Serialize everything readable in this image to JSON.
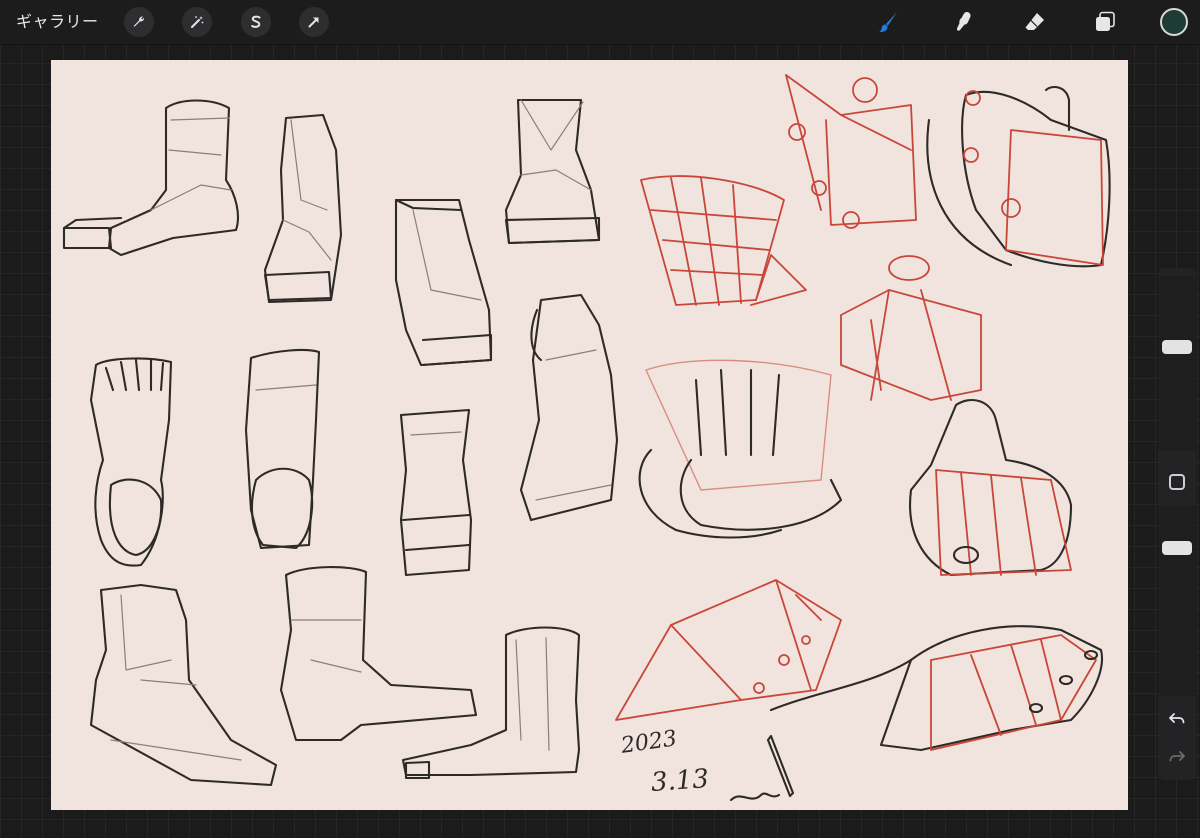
{
  "app": {
    "gallery_label": "ギャラリー",
    "color_swatch": "#1f3b36",
    "canvas_bg": "#f1e4de",
    "accent": "#1e7fe6"
  },
  "toolbar_left": [
    {
      "name": "wrench-icon"
    },
    {
      "name": "magic-wand-icon"
    },
    {
      "name": "selection-s-icon"
    },
    {
      "name": "transform-arrow-icon"
    }
  ],
  "toolbar_right": [
    {
      "name": "brush-icon",
      "active": true
    },
    {
      "name": "smudge-icon"
    },
    {
      "name": "eraser-icon"
    },
    {
      "name": "layers-icon"
    }
  ],
  "sidebar": {
    "brush_size_level": 0.15,
    "opacity_level": 0.2
  },
  "canvas_text": {
    "date_year": "2023",
    "date_day": "3.13"
  }
}
